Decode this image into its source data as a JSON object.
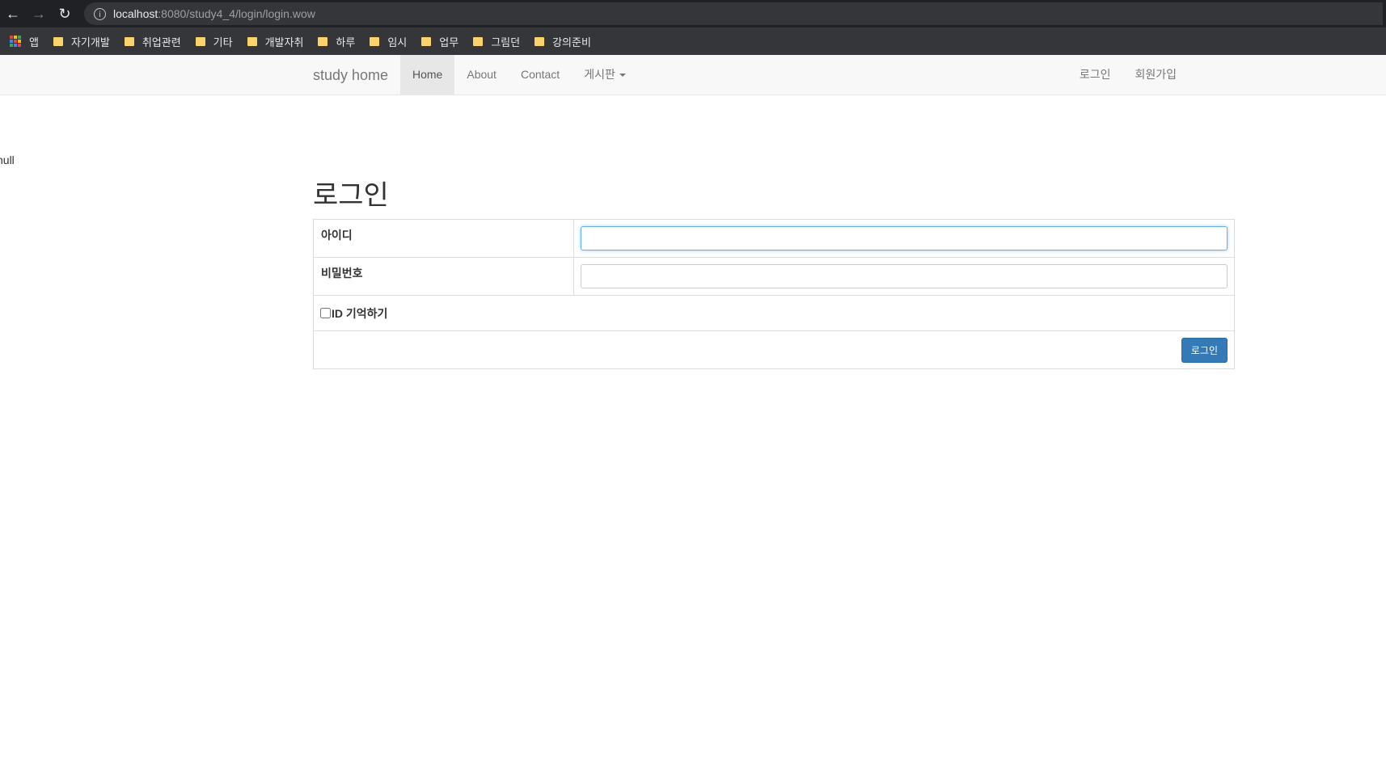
{
  "browser": {
    "url_host": "localhost",
    "url_rest": ":8080/study4_4/login/login.wow",
    "bookmarks": [
      {
        "label": "앱",
        "icon": "apps-grid-icon"
      },
      {
        "label": "자기개발",
        "icon": "folder-icon"
      },
      {
        "label": "취업관련",
        "icon": "folder-icon"
      },
      {
        "label": "기타",
        "icon": "folder-icon"
      },
      {
        "label": "개발자취",
        "icon": "folder-icon"
      },
      {
        "label": "하루",
        "icon": "folder-icon"
      },
      {
        "label": "임시",
        "icon": "folder-icon"
      },
      {
        "label": "업무",
        "icon": "folder-icon"
      },
      {
        "label": "그림던",
        "icon": "folder-icon"
      },
      {
        "label": "강의준비",
        "icon": "folder-icon"
      }
    ]
  },
  "navbar": {
    "brand": "study home",
    "links": [
      "Home",
      "About",
      "Contact",
      "게시판"
    ],
    "right_links": [
      "로그인",
      "회원가입"
    ]
  },
  "debug_text": "null",
  "login": {
    "title": "로그인",
    "id_label": "아이디",
    "id_value": "",
    "password_label": "비밀번호",
    "password_value": "",
    "remember_label": "ID 기억하기",
    "submit_label": "로그인"
  },
  "colors": {
    "primary": "#337ab7",
    "navbar_bg": "#f8f8f8",
    "chrome_bg": "#202124"
  }
}
